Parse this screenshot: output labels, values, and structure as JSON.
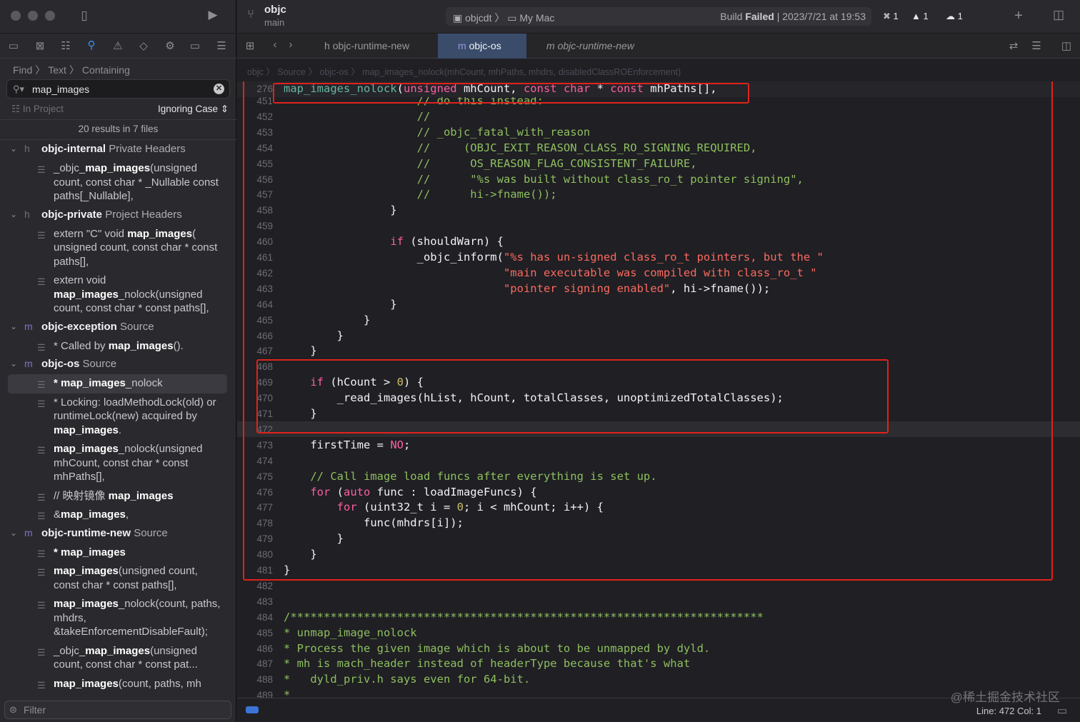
{
  "window": {
    "project": "objc",
    "branch": "main"
  },
  "scheme": {
    "target": "objcdt",
    "destination": "My Mac",
    "status_prefix": "Build",
    "status_bold": "Failed",
    "status_time": "| 2023/7/21 at 19:53"
  },
  "badges": {
    "errors": "1",
    "warnings": "1",
    "cloud": "1"
  },
  "find": {
    "mode1": "Find",
    "mode2": "Text",
    "mode3": "Containing",
    "query": "map_images",
    "scope": "In Project",
    "case": "Ignoring Case",
    "summary": "20 results in 7 files",
    "filter_placeholder": "Filter"
  },
  "tabs": [
    "objc-runtime-new",
    "objc-os",
    "objc-runtime-new"
  ],
  "jumpbar": "objc 〉 Source 〉 objc-os 〉 map_images_nolock(mhCount, mhPaths, mhdrs, disabledClassROEnforcement)",
  "results": {
    "g1": {
      "name": "objc-internal",
      "kind": "Private Headers"
    },
    "g1m1": {
      "a": "_objc_",
      "b": "map_images",
      "c": "(unsigned count, const char * _Nullable const paths[_Nullable],"
    },
    "g2": {
      "name": "objc-private",
      "kind": "Project Headers"
    },
    "g2m1": {
      "a": "extern \"C\" void ",
      "b": "map_images",
      "c": "( unsigned count, const char * const paths[],"
    },
    "g2m2": {
      "a": "extern void ",
      "b": "map_images",
      "c": "_nolock(unsigned count, const char * const paths[],"
    },
    "g3": {
      "name": "objc-exception",
      "kind": "Source"
    },
    "g3m1": {
      "a": "* Called by ",
      "b": "map_images",
      "c": "()."
    },
    "g4": {
      "name": "objc-os",
      "kind": "Source"
    },
    "g4m1": {
      "a": "* ",
      "b": "map_images",
      "c": "_nolock"
    },
    "g4m2": {
      "a": "* Locking: loadMethodLock(old) or runtimeLock(new) acquired by ",
      "b": "map_images",
      "c": "."
    },
    "g4m3": {
      "a": "",
      "b": "map_images",
      "c": "_nolock(unsigned mhCount, const char * const mhPaths[],"
    },
    "g4m4": {
      "a": "// 映射镜像 ",
      "b": "map_images",
      "c": ""
    },
    "g4m5": {
      "a": "&",
      "b": "map_images",
      "c": ","
    },
    "g5": {
      "name": "objc-runtime-new",
      "kind": "Source"
    },
    "g5m1": {
      "a": "* ",
      "b": "map_images",
      "c": ""
    },
    "g5m2": {
      "a": "",
      "b": "map_images",
      "c": "(unsigned count, const char * const paths[],"
    },
    "g5m3": {
      "a": "",
      "b": "map_images",
      "c": "_nolock(count, paths, mhdrs, &takeEnforcementDisableFault);"
    },
    "g5m4": {
      "a": "_objc_",
      "b": "map_images",
      "c": "(unsigned count, const char * const pat..."
    },
    "g5m5": {
      "a": "",
      "b": "map_images",
      "c": "(count, paths, mh"
    }
  },
  "code": {
    "sticky_num": "276",
    "sticky": [
      [
        "fn",
        "map_images_nolock"
      ],
      [
        "",
        "("
      ],
      [
        "kw",
        "unsigned"
      ],
      [
        "",
        " mhCount, "
      ],
      [
        "kw",
        "const char"
      ],
      [
        "",
        " * "
      ],
      [
        "kw",
        "const"
      ],
      [
        "",
        " mhPaths[],"
      ]
    ],
    "lines": [
      {
        "n": "451",
        "t": [
          [
            "cm",
            "                    // do this instead:"
          ]
        ]
      },
      {
        "n": "452",
        "t": [
          [
            "cm",
            "                    //"
          ]
        ]
      },
      {
        "n": "453",
        "t": [
          [
            "cm",
            "                    // _objc_fatal_with_reason"
          ]
        ]
      },
      {
        "n": "454",
        "t": [
          [
            "cm",
            "                    //     (OBJC_EXIT_REASON_CLASS_RO_SIGNING_REQUIRED,"
          ]
        ]
      },
      {
        "n": "455",
        "t": [
          [
            "cm",
            "                    //      OS_REASON_FLAG_CONSISTENT_FAILURE,"
          ]
        ]
      },
      {
        "n": "456",
        "t": [
          [
            "cm",
            "                    //      \"%s was built without class_ro_t pointer signing\","
          ]
        ]
      },
      {
        "n": "457",
        "t": [
          [
            "cm",
            "                    //      hi->fname());"
          ]
        ]
      },
      {
        "n": "458",
        "t": [
          [
            "",
            "                }"
          ]
        ]
      },
      {
        "n": "459",
        "t": [
          [
            "",
            ""
          ]
        ]
      },
      {
        "n": "460",
        "t": [
          [
            "",
            "                "
          ],
          [
            "kw",
            "if"
          ],
          [
            "",
            " (shouldWarn) {"
          ]
        ]
      },
      {
        "n": "461",
        "t": [
          [
            "",
            "                    _objc_inform("
          ],
          [
            "st",
            "\"%s has un-signed class_ro_t pointers, but the \""
          ]
        ]
      },
      {
        "n": "462",
        "t": [
          [
            "",
            "                                 "
          ],
          [
            "st",
            "\"main executable was compiled with class_ro_t \""
          ]
        ]
      },
      {
        "n": "463",
        "t": [
          [
            "",
            "                                 "
          ],
          [
            "st",
            "\"pointer signing enabled\""
          ],
          [
            "",
            ", hi->fname());"
          ]
        ]
      },
      {
        "n": "464",
        "t": [
          [
            "",
            "                }"
          ]
        ]
      },
      {
        "n": "465",
        "t": [
          [
            "",
            "            }"
          ]
        ]
      },
      {
        "n": "466",
        "t": [
          [
            "",
            "        }"
          ]
        ]
      },
      {
        "n": "467",
        "t": [
          [
            "",
            "    }"
          ]
        ]
      },
      {
        "n": "468",
        "t": [
          [
            "",
            ""
          ]
        ]
      },
      {
        "n": "469",
        "t": [
          [
            "",
            "    "
          ],
          [
            "kw",
            "if"
          ],
          [
            "",
            " (hCount > "
          ],
          [
            "nu",
            "0"
          ],
          [
            "",
            ") {"
          ]
        ]
      },
      {
        "n": "470",
        "t": [
          [
            "",
            "        _read_images(hList, hCount, totalClasses, unoptimizedTotalClasses);"
          ]
        ]
      },
      {
        "n": "471",
        "t": [
          [
            "",
            "    }"
          ]
        ]
      },
      {
        "n": "472",
        "t": [
          [
            "",
            ""
          ]
        ]
      },
      {
        "n": "473",
        "t": [
          [
            "",
            "    firstTime = "
          ],
          [
            "kw",
            "NO"
          ],
          [
            "",
            ";"
          ]
        ]
      },
      {
        "n": "474",
        "t": [
          [
            "",
            ""
          ]
        ]
      },
      {
        "n": "475",
        "t": [
          [
            "cm",
            "    // Call image load funcs after everything is set up."
          ]
        ]
      },
      {
        "n": "476",
        "t": [
          [
            "",
            "    "
          ],
          [
            "kw",
            "for"
          ],
          [
            "",
            " ("
          ],
          [
            "kw",
            "auto"
          ],
          [
            "",
            " func : loadImageFuncs) {"
          ]
        ]
      },
      {
        "n": "477",
        "t": [
          [
            "",
            "        "
          ],
          [
            "kw",
            "for"
          ],
          [
            "",
            " (uint32_t i = "
          ],
          [
            "nu",
            "0"
          ],
          [
            "",
            "; i < mhCount; i++) {"
          ]
        ]
      },
      {
        "n": "478",
        "t": [
          [
            "",
            "            func(mhdrs[i]);"
          ]
        ]
      },
      {
        "n": "479",
        "t": [
          [
            "",
            "        }"
          ]
        ]
      },
      {
        "n": "480",
        "t": [
          [
            "",
            "    }"
          ]
        ]
      },
      {
        "n": "481",
        "t": [
          [
            "",
            "}"
          ]
        ]
      },
      {
        "n": "482",
        "t": [
          [
            "",
            ""
          ]
        ]
      },
      {
        "n": "483",
        "t": [
          [
            "",
            ""
          ]
        ]
      },
      {
        "n": "484",
        "t": [
          [
            "cm",
            "/***********************************************************************"
          ]
        ]
      },
      {
        "n": "485",
        "t": [
          [
            "cm",
            "* unmap_image_nolock"
          ]
        ]
      },
      {
        "n": "486",
        "t": [
          [
            "cm",
            "* Process the given image which is about to be unmapped by dyld."
          ]
        ]
      },
      {
        "n": "487",
        "t": [
          [
            "cm",
            "* mh is mach_header instead of headerType because that's what"
          ]
        ]
      },
      {
        "n": "488",
        "t": [
          [
            "cm",
            "*   dyld_priv.h says even for 64-bit."
          ]
        ]
      },
      {
        "n": "489",
        "t": [
          [
            "cm",
            "*"
          ]
        ]
      }
    ]
  },
  "status": {
    "linecol": "Line: 472  Col: 1"
  },
  "watermark": "@稀土掘金技术社区"
}
